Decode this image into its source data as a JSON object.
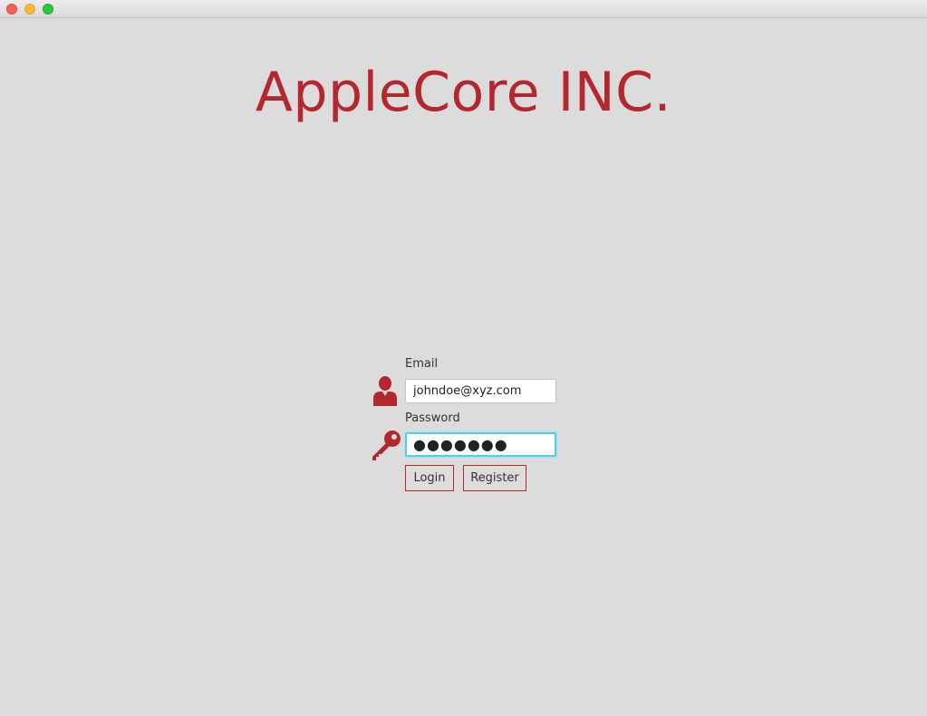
{
  "window": {
    "controls": [
      "close",
      "minimize",
      "maximize"
    ]
  },
  "brand": {
    "title": "AppleCore INC.",
    "color": "#b5272f"
  },
  "login_form": {
    "email": {
      "label": "Email",
      "value": "johndoe@xyz.com",
      "icon": "user-icon"
    },
    "password": {
      "label": "Password",
      "masked_value": "●●●●●●●",
      "focused": true,
      "icon": "key-icon"
    },
    "buttons": {
      "login_label": "Login",
      "register_label": "Register"
    }
  },
  "colors": {
    "background": "#dcdcdc",
    "accent": "#b5272f",
    "focus_ring": "#4fd0ea"
  }
}
